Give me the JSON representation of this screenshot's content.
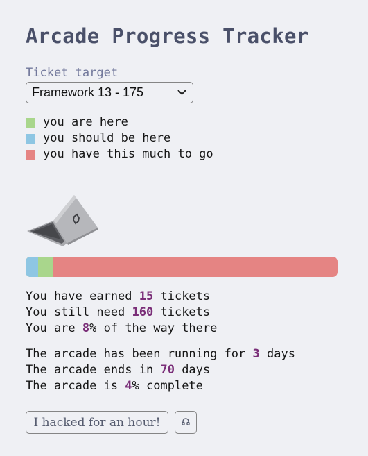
{
  "title": "Arcade Progress Tracker",
  "target": {
    "label": "Ticket target",
    "selected": "Framework 13 - 175"
  },
  "legend": [
    {
      "label": "you are here",
      "color": "#a9d68c"
    },
    {
      "label": "you should be here",
      "color": "#8ec6e3"
    },
    {
      "label": "you have this much to go",
      "color": "#e58483"
    }
  ],
  "progress": {
    "earned_fraction": 0.086,
    "expected_fraction": 0.04
  },
  "tickets": {
    "earned_prefix": "You have earned ",
    "earned": "15",
    "earned_suffix": " tickets",
    "need_prefix": "You still need ",
    "need": "160",
    "need_suffix": " tickets",
    "pct_prefix": "You are ",
    "pct": "8",
    "pct_suffix": "% of the way there"
  },
  "arcade": {
    "running_prefix": "The arcade has been running for ",
    "running": "3",
    "running_suffix": " days",
    "ends_prefix": "The arcade ends in ",
    "ends": "70",
    "ends_suffix": " days",
    "complete_prefix": "The arcade is ",
    "complete": "4",
    "complete_suffix": "% complete"
  },
  "buttons": {
    "hacked": "I hacked for an hour!",
    "icon": "headphones-icon"
  }
}
